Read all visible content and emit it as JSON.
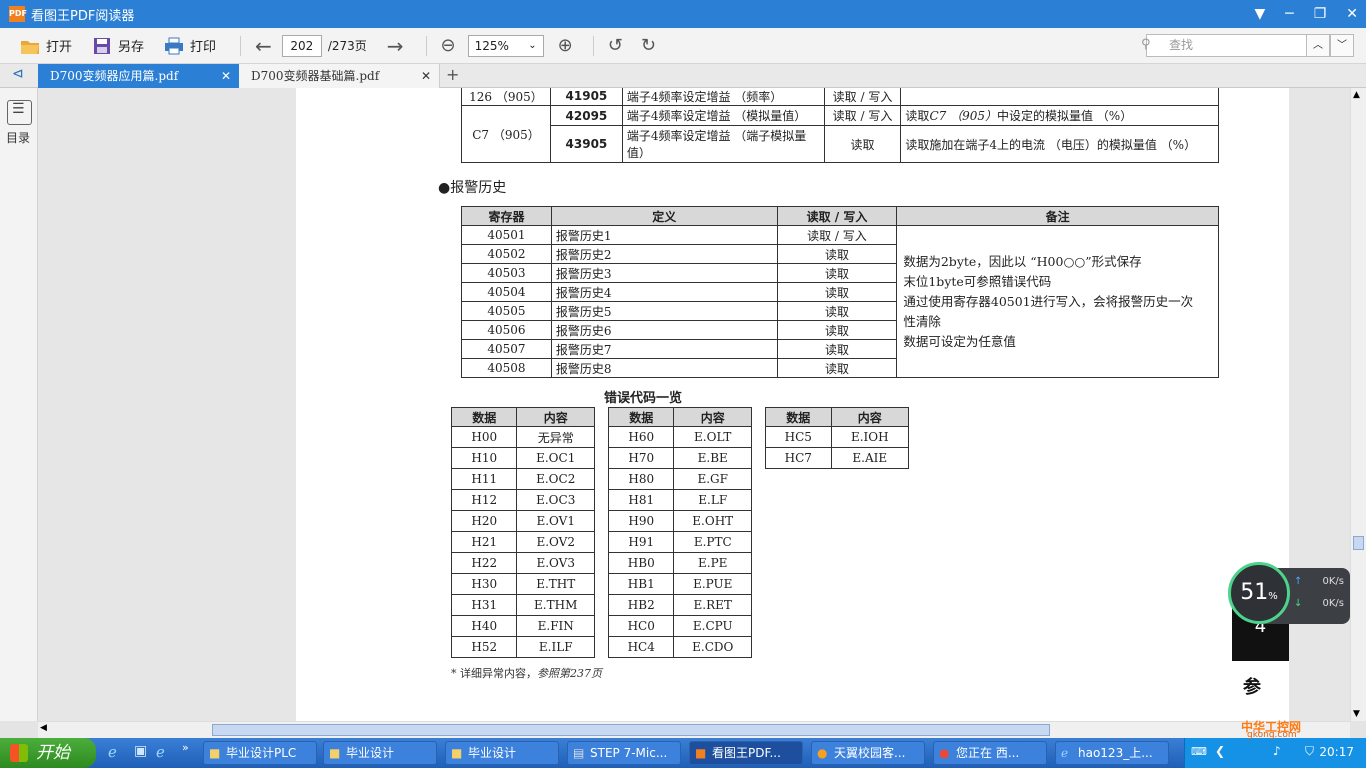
{
  "app": {
    "title": "看图王PDF阅读器",
    "logo_text": "PDF"
  },
  "toolbar": {
    "open": "打开",
    "save_as": "另存",
    "print": "打印",
    "page_current": "202",
    "page_total": "/273页",
    "zoom": "125%",
    "search_placeholder": "查找"
  },
  "tabs": [
    {
      "label": "D700变频器应用篇.pdf",
      "active": true
    },
    {
      "label": "D700变频器基础篇.pdf",
      "active": false
    }
  ],
  "sidebar": {
    "toc_label": "目录"
  },
  "doc": {
    "top_table": {
      "rows": [
        {
          "param": "126 （905）",
          "reg": "41905",
          "content": "端子4频率设定增益 （频率）",
          "rw": "读取 / 写入",
          "note": ""
        },
        {
          "param": "C7 （905）",
          "reg": "42095",
          "content": "端子4频率设定增益 （模拟量值）",
          "rw": "读取 / 写入",
          "note_pre": "读取",
          "note_em": "C7 （905）",
          "note_post": "中设定的模拟量值 （%）"
        },
        {
          "param": "",
          "reg": "43905",
          "content": "端子4频率设定增益 （端子模拟量值）",
          "rw": "读取",
          "note": "读取施加在端子4上的电流 （电压）的模拟量值 （%）"
        }
      ]
    },
    "alarm_section_title": "●报警历史",
    "alarm_table": {
      "headers": [
        "寄存器",
        "定义",
        "读取 / 写入",
        "备注"
      ],
      "rows": [
        {
          "reg": "40501",
          "def": "报警历史1",
          "rw": "读取 / 写入"
        },
        {
          "reg": "40502",
          "def": "报警历史2",
          "rw": "读取"
        },
        {
          "reg": "40503",
          "def": "报警历史3",
          "rw": "读取"
        },
        {
          "reg": "40504",
          "def": "报警历史4",
          "rw": "读取"
        },
        {
          "reg": "40505",
          "def": "报警历史5",
          "rw": "读取"
        },
        {
          "reg": "40506",
          "def": "报警历史6",
          "rw": "读取"
        },
        {
          "reg": "40507",
          "def": "报警历史7",
          "rw": "读取"
        },
        {
          "reg": "40508",
          "def": "报警历史8",
          "rw": "读取"
        }
      ],
      "note_lines": [
        "数据为2byte，因此以 “H00○○”形式保存",
        "末位1byte可参照错误代码",
        "通过使用寄存器40501进行写入，会将报警历史一次",
        "性清除",
        "数据可设定为任意值"
      ]
    },
    "error_code_title": "错误代码一览",
    "error_headers": [
      "数据",
      "内容"
    ],
    "error_tables": [
      [
        [
          "H00",
          "无异常"
        ],
        [
          "H10",
          "E.OC1"
        ],
        [
          "H11",
          "E.OC2"
        ],
        [
          "H12",
          "E.OC3"
        ],
        [
          "H20",
          "E.OV1"
        ],
        [
          "H21",
          "E.OV2"
        ],
        [
          "H22",
          "E.OV3"
        ],
        [
          "H30",
          "E.THT"
        ],
        [
          "H31",
          "E.THM"
        ],
        [
          "H40",
          "E.FIN"
        ],
        [
          "H52",
          "E.ILF"
        ]
      ],
      [
        [
          "H60",
          "E.OLT"
        ],
        [
          "H70",
          "E.BE"
        ],
        [
          "H80",
          "E.GF"
        ],
        [
          "H81",
          "E.LF"
        ],
        [
          "H90",
          "E.OHT"
        ],
        [
          "H91",
          "E.PTC"
        ],
        [
          "HB0",
          "E.PE"
        ],
        [
          "HB1",
          "E.PUE"
        ],
        [
          "HB2",
          "E.RET"
        ],
        [
          "HC0",
          "E.CPU"
        ],
        [
          "HC4",
          "E.CDO"
        ]
      ],
      [
        [
          "HC5",
          "E.IOH"
        ],
        [
          "HC7",
          "E.AIE"
        ]
      ]
    ],
    "footnote_pre": "*  详细异常内容，",
    "footnote_em": "参照第237页",
    "side_char": "参",
    "side_num": "4"
  },
  "monitor": {
    "percent": "51",
    "percent_sign": "%",
    "up": "0K/s",
    "down": "0K/s"
  },
  "taskbar": {
    "start": "开始",
    "tasks": [
      "毕业设计PLC",
      "毕业设计",
      "毕业设计",
      "STEP 7-Mic...",
      "看图王PDF...",
      "天翼校园客...",
      "您正在 西...",
      "hao123_上..."
    ],
    "time": "20:17",
    "watermark": "中华工控网",
    "watermark_url": "gkong.com"
  }
}
